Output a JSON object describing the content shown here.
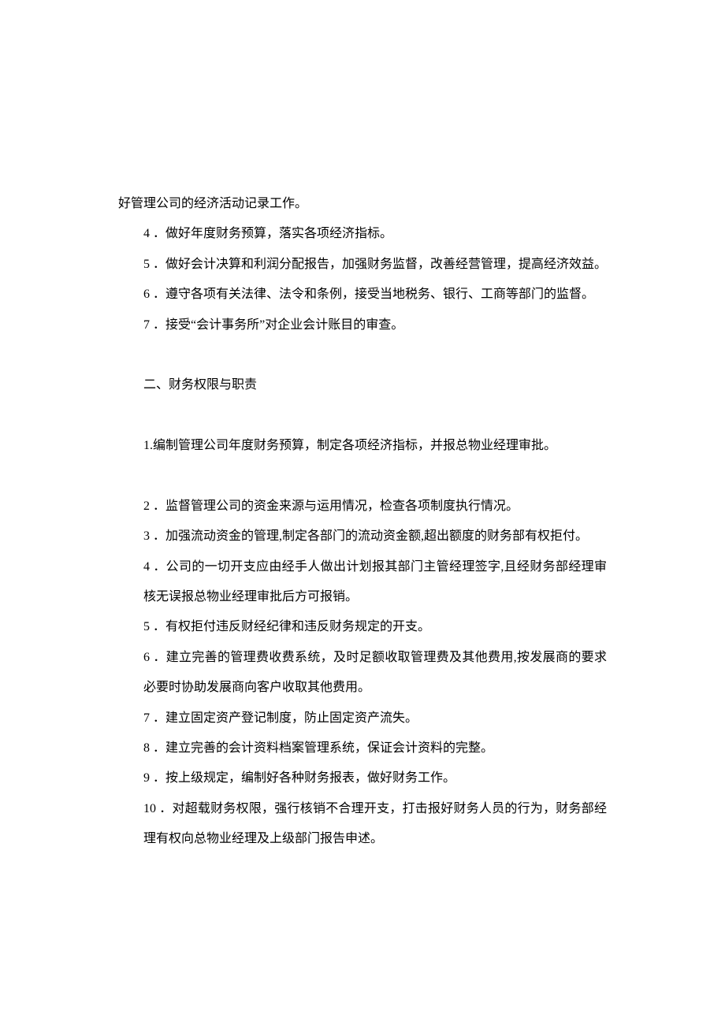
{
  "lines": {
    "l1": "好管理公司的经济活动记录工作。",
    "l2": "4 ．做好年度财务预算，落实各项经济指标。",
    "l3": "5 ．做好会计决算和利润分配报告，加强财务监督，改善经营管理，提高经济效益。",
    "l4": "6 ．遵守各项有关法律、法令和条例，接受当地税务、银行、工商等部门的监督。",
    "l5": "7 ．接受“会计事务所”对企业会计账目的审查。",
    "h2": "二、财务权限与职责",
    "l6": "1.编制管理公司年度财务预算，制定各项经济指标，并报总物业经理审批。",
    "l7": "2 ．监督管理公司的资金来源与运用情况，检查各项制度执行情况。",
    "l8": "3 ．加强流动资金的管理,制定各部门的流动资金额,超出额度的财务部有权拒付。",
    "l9": "4 ．公司的一切开支应由经手人做出计划报其部门主管经理签字,且经财务部经理审核无误报总物业经理审批后方可报销。",
    "l10": "5 ．有权拒付违反财经纪律和违反财务规定的开支。",
    "l11": "6 ．建立完善的管理费收费系统，及时足额收取管理费及其他费用,按发展商的要求必要时协助发展商向客户收取其他费用。",
    "l12": "7 ．建立固定资产登记制度，防止固定资产流失。",
    "l13": "8 ．建立完善的会计资料档案管理系统，保证会计资料的完整。",
    "l14": "9 ．按上级规定，编制好各种财务报表，做好财务工作。",
    "l15": "10 ．对超载财务权限，强行核销不合理开支，打击报好财务人员的行为，财务部经理有权向总物业经理及上级部门报告申述。"
  }
}
